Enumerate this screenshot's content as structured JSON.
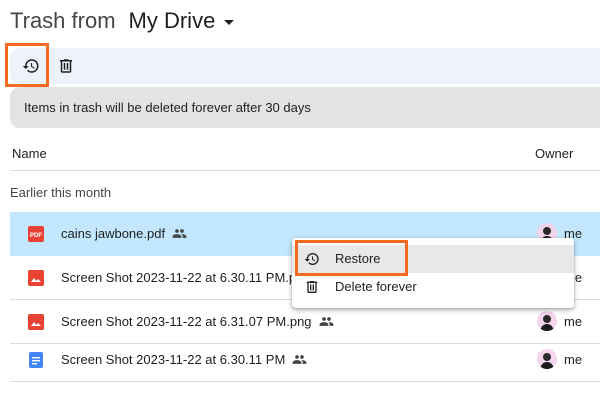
{
  "header": {
    "prefix": "Trash from",
    "drive": "My Drive"
  },
  "toolbar": {
    "restore_icon": "restore-history-icon",
    "delete_icon": "trash-icon"
  },
  "banner": {
    "text": "Items in trash will be deleted forever after 30 days"
  },
  "columns": {
    "name": "Name",
    "owner": "Owner"
  },
  "section": {
    "label": "Earlier this month"
  },
  "files": [
    {
      "name": "cains jawbone.pdf",
      "type": "pdf",
      "owner": "me",
      "shared": true,
      "selected": true
    },
    {
      "name": "Screen Shot 2023-11-22 at 6.30.11 PM.png",
      "type": "image",
      "owner": "me",
      "shared": true,
      "selected": false
    },
    {
      "name": "Screen Shot 2023-11-22 at 6.31.07 PM.png",
      "type": "image",
      "owner": "me",
      "shared": true,
      "selected": false
    },
    {
      "name": "Screen Shot 2023-11-22 at 6.30.11 PM",
      "type": "doc",
      "owner": "me",
      "shared": true,
      "selected": false
    }
  ],
  "menu": {
    "restore": "Restore",
    "delete_forever": "Delete forever"
  },
  "colors": {
    "selected_row": "#c2e7ff",
    "highlight": "#f26b21",
    "pdf_red": "#e94235",
    "image_red": "#ea4335",
    "doc_blue": "#4285f4"
  }
}
